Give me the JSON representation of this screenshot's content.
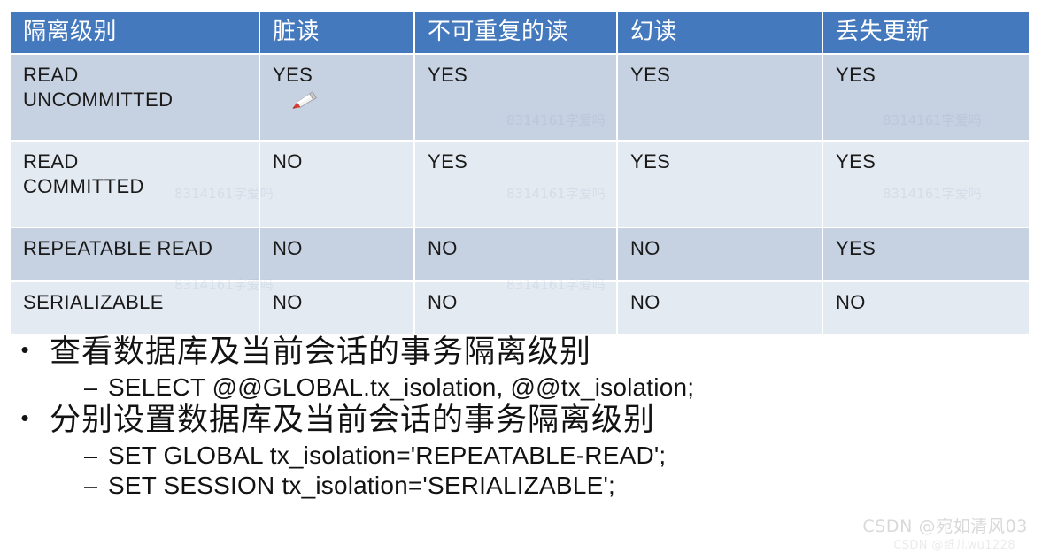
{
  "table": {
    "headers": [
      "隔离级别",
      "脏读",
      "不可重复的读",
      "幻读",
      "丢失更新"
    ],
    "rows": [
      {
        "level": "READ\nUNCOMMITTED",
        "dirty_read": "YES",
        "non_repeatable_read": "YES",
        "phantom_read": "YES",
        "lost_update": "YES",
        "has_pen_icon": true
      },
      {
        "level": "READ\nCOMMITTED",
        "dirty_read": "NO",
        "non_repeatable_read": "YES",
        "phantom_read": "YES",
        "lost_update": "YES",
        "has_pen_icon": false
      },
      {
        "level": "REPEATABLE READ",
        "dirty_read": "NO",
        "non_repeatable_read": "NO",
        "phantom_read": "NO",
        "lost_update": "YES",
        "has_pen_icon": false
      },
      {
        "level": "SERIALIZABLE",
        "dirty_read": "NO",
        "non_repeatable_read": "NO",
        "phantom_read": "NO",
        "lost_update": "NO",
        "has_pen_icon": false
      }
    ],
    "colors": {
      "header_bg": "#4579be",
      "header_text": "#ffffff",
      "row_dark_bg": "#c6d1e1",
      "row_light_bg": "#e4eaf1",
      "cell_text": "#1a1a1a",
      "grid_line": "#ffffff"
    }
  },
  "bullets": [
    {
      "marker": "•",
      "text": "查看数据库及当前会话的事务隔离级别",
      "sub": [
        {
          "marker": "–",
          "text": "SELECT @@GLOBAL.tx_isolation, @@tx_isolation;"
        }
      ]
    },
    {
      "marker": "•",
      "text": "分别设置数据库及当前会话的事务隔离级别",
      "sub": [
        {
          "marker": "–",
          "text": "SET GLOBAL tx_isolation='REPEATABLE-READ';"
        },
        {
          "marker": "–",
          "text": "SET SESSION tx_isolation='SERIALIZABLE';"
        }
      ]
    }
  ],
  "watermarks": {
    "main": "CSDN @宛如清风03",
    "sub": "CSDN @纸儿wu1228",
    "ghost": "8314161字爱吗"
  }
}
